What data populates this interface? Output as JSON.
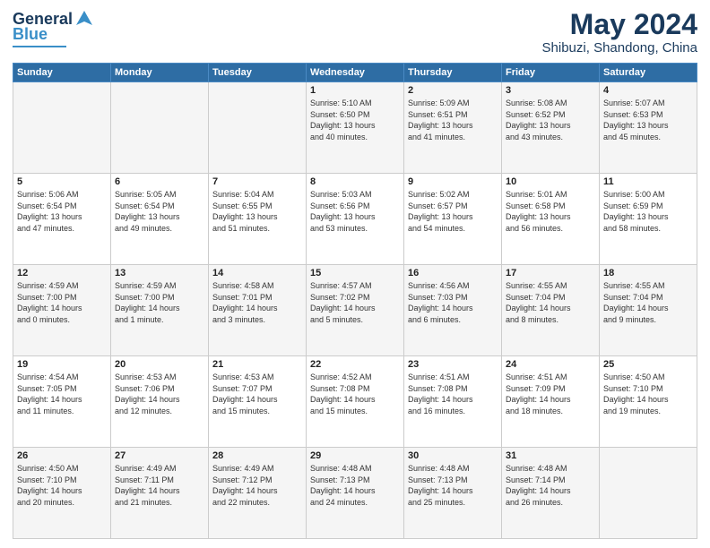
{
  "header": {
    "logo_general": "General",
    "logo_blue": "Blue",
    "month_title": "May 2024",
    "location": "Shibuzi, Shandong, China"
  },
  "weekdays": [
    "Sunday",
    "Monday",
    "Tuesday",
    "Wednesday",
    "Thursday",
    "Friday",
    "Saturday"
  ],
  "weeks": [
    [
      {
        "day": "",
        "info": ""
      },
      {
        "day": "",
        "info": ""
      },
      {
        "day": "",
        "info": ""
      },
      {
        "day": "1",
        "info": "Sunrise: 5:10 AM\nSunset: 6:50 PM\nDaylight: 13 hours\nand 40 minutes."
      },
      {
        "day": "2",
        "info": "Sunrise: 5:09 AM\nSunset: 6:51 PM\nDaylight: 13 hours\nand 41 minutes."
      },
      {
        "day": "3",
        "info": "Sunrise: 5:08 AM\nSunset: 6:52 PM\nDaylight: 13 hours\nand 43 minutes."
      },
      {
        "day": "4",
        "info": "Sunrise: 5:07 AM\nSunset: 6:53 PM\nDaylight: 13 hours\nand 45 minutes."
      }
    ],
    [
      {
        "day": "5",
        "info": "Sunrise: 5:06 AM\nSunset: 6:54 PM\nDaylight: 13 hours\nand 47 minutes."
      },
      {
        "day": "6",
        "info": "Sunrise: 5:05 AM\nSunset: 6:54 PM\nDaylight: 13 hours\nand 49 minutes."
      },
      {
        "day": "7",
        "info": "Sunrise: 5:04 AM\nSunset: 6:55 PM\nDaylight: 13 hours\nand 51 minutes."
      },
      {
        "day": "8",
        "info": "Sunrise: 5:03 AM\nSunset: 6:56 PM\nDaylight: 13 hours\nand 53 minutes."
      },
      {
        "day": "9",
        "info": "Sunrise: 5:02 AM\nSunset: 6:57 PM\nDaylight: 13 hours\nand 54 minutes."
      },
      {
        "day": "10",
        "info": "Sunrise: 5:01 AM\nSunset: 6:58 PM\nDaylight: 13 hours\nand 56 minutes."
      },
      {
        "day": "11",
        "info": "Sunrise: 5:00 AM\nSunset: 6:59 PM\nDaylight: 13 hours\nand 58 minutes."
      }
    ],
    [
      {
        "day": "12",
        "info": "Sunrise: 4:59 AM\nSunset: 7:00 PM\nDaylight: 14 hours\nand 0 minutes."
      },
      {
        "day": "13",
        "info": "Sunrise: 4:59 AM\nSunset: 7:00 PM\nDaylight: 14 hours\nand 1 minute."
      },
      {
        "day": "14",
        "info": "Sunrise: 4:58 AM\nSunset: 7:01 PM\nDaylight: 14 hours\nand 3 minutes."
      },
      {
        "day": "15",
        "info": "Sunrise: 4:57 AM\nSunset: 7:02 PM\nDaylight: 14 hours\nand 5 minutes."
      },
      {
        "day": "16",
        "info": "Sunrise: 4:56 AM\nSunset: 7:03 PM\nDaylight: 14 hours\nand 6 minutes."
      },
      {
        "day": "17",
        "info": "Sunrise: 4:55 AM\nSunset: 7:04 PM\nDaylight: 14 hours\nand 8 minutes."
      },
      {
        "day": "18",
        "info": "Sunrise: 4:55 AM\nSunset: 7:04 PM\nDaylight: 14 hours\nand 9 minutes."
      }
    ],
    [
      {
        "day": "19",
        "info": "Sunrise: 4:54 AM\nSunset: 7:05 PM\nDaylight: 14 hours\nand 11 minutes."
      },
      {
        "day": "20",
        "info": "Sunrise: 4:53 AM\nSunset: 7:06 PM\nDaylight: 14 hours\nand 12 minutes."
      },
      {
        "day": "21",
        "info": "Sunrise: 4:53 AM\nSunset: 7:07 PM\nDaylight: 14 hours\nand 15 minutes."
      },
      {
        "day": "22",
        "info": "Sunrise: 4:52 AM\nSunset: 7:08 PM\nDaylight: 14 hours\nand 15 minutes."
      },
      {
        "day": "23",
        "info": "Sunrise: 4:51 AM\nSunset: 7:08 PM\nDaylight: 14 hours\nand 16 minutes."
      },
      {
        "day": "24",
        "info": "Sunrise: 4:51 AM\nSunset: 7:09 PM\nDaylight: 14 hours\nand 18 minutes."
      },
      {
        "day": "25",
        "info": "Sunrise: 4:50 AM\nSunset: 7:10 PM\nDaylight: 14 hours\nand 19 minutes."
      }
    ],
    [
      {
        "day": "26",
        "info": "Sunrise: 4:50 AM\nSunset: 7:10 PM\nDaylight: 14 hours\nand 20 minutes."
      },
      {
        "day": "27",
        "info": "Sunrise: 4:49 AM\nSunset: 7:11 PM\nDaylight: 14 hours\nand 21 minutes."
      },
      {
        "day": "28",
        "info": "Sunrise: 4:49 AM\nSunset: 7:12 PM\nDaylight: 14 hours\nand 22 minutes."
      },
      {
        "day": "29",
        "info": "Sunrise: 4:48 AM\nSunset: 7:13 PM\nDaylight: 14 hours\nand 24 minutes."
      },
      {
        "day": "30",
        "info": "Sunrise: 4:48 AM\nSunset: 7:13 PM\nDaylight: 14 hours\nand 25 minutes."
      },
      {
        "day": "31",
        "info": "Sunrise: 4:48 AM\nSunset: 7:14 PM\nDaylight: 14 hours\nand 26 minutes."
      },
      {
        "day": "",
        "info": ""
      }
    ]
  ]
}
